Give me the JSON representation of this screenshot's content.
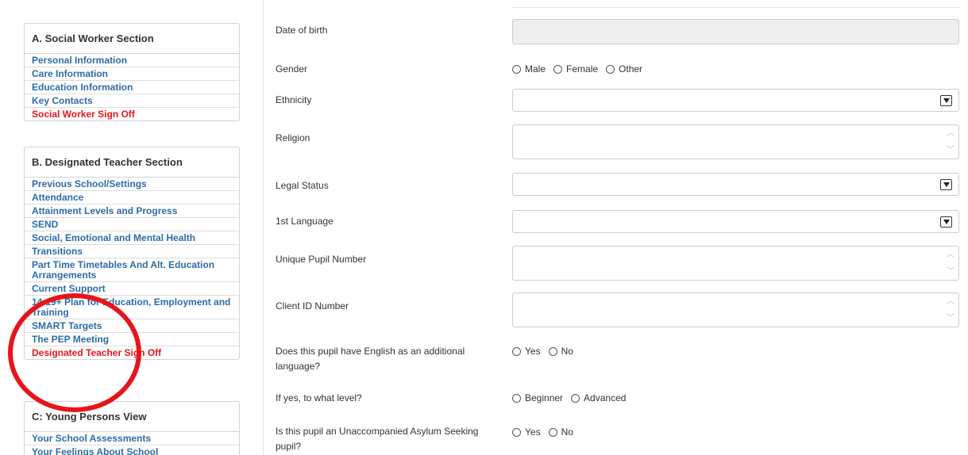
{
  "sidebar": {
    "sections": [
      {
        "title": "A. Social Worker Section",
        "items": [
          {
            "label": "Personal Information",
            "signoff": false
          },
          {
            "label": "Care Information",
            "signoff": false
          },
          {
            "label": "Education Information",
            "signoff": false
          },
          {
            "label": "Key Contacts",
            "signoff": false
          },
          {
            "label": "Social Worker Sign Off",
            "signoff": true
          }
        ]
      },
      {
        "title": "B. Designated Teacher Section",
        "items": [
          {
            "label": "Previous School/Settings",
            "signoff": false
          },
          {
            "label": "Attendance",
            "signoff": false
          },
          {
            "label": "Attainment Levels and Progress",
            "signoff": false
          },
          {
            "label": "SEND",
            "signoff": false
          },
          {
            "label": "Social, Emotional and Mental Health",
            "signoff": false
          },
          {
            "label": "Transitions",
            "signoff": false
          },
          {
            "label": "Part Time Timetables And Alt. Education Arrangements",
            "signoff": false
          },
          {
            "label": "Current Support",
            "signoff": false
          },
          {
            "label": "14-19+ Plan for Education, Employment and Training",
            "signoff": false
          },
          {
            "label": "SMART Targets",
            "signoff": false
          },
          {
            "label": "The PEP Meeting",
            "signoff": false
          },
          {
            "label": "Designated Teacher Sign Off",
            "signoff": true
          }
        ]
      },
      {
        "title": "C: Young Persons View",
        "items": [
          {
            "label": "Your School Assessments",
            "signoff": false
          },
          {
            "label": "Your Feelings About School",
            "signoff": false
          }
        ]
      }
    ]
  },
  "form": {
    "date_of_birth": {
      "label": "Date of birth",
      "value": ""
    },
    "gender": {
      "label": "Gender",
      "options": [
        "Male",
        "Female",
        "Other"
      ]
    },
    "ethnicity": {
      "label": "Ethnicity",
      "value": ""
    },
    "religion": {
      "label": "Religion",
      "value": ""
    },
    "legal_status": {
      "label": "Legal Status",
      "value": ""
    },
    "first_language": {
      "label": "1st Language",
      "value": ""
    },
    "upn": {
      "label": "Unique Pupil Number",
      "value": ""
    },
    "client_id": {
      "label": "Client ID Number",
      "value": ""
    },
    "eal": {
      "label": "Does this pupil have English as an additional language?",
      "options": [
        "Yes",
        "No"
      ]
    },
    "eal_level": {
      "label": "If yes, to what level?",
      "options": [
        "Beginner",
        "Advanced"
      ]
    },
    "uasc": {
      "label": "Is this pupil an Unaccompanied Asylum Seeking pupil?",
      "options": [
        "Yes",
        "No"
      ]
    }
  },
  "colors": {
    "link": "#2d6ca8",
    "signoff": "#e8141b",
    "annotation": "#e8141b"
  }
}
